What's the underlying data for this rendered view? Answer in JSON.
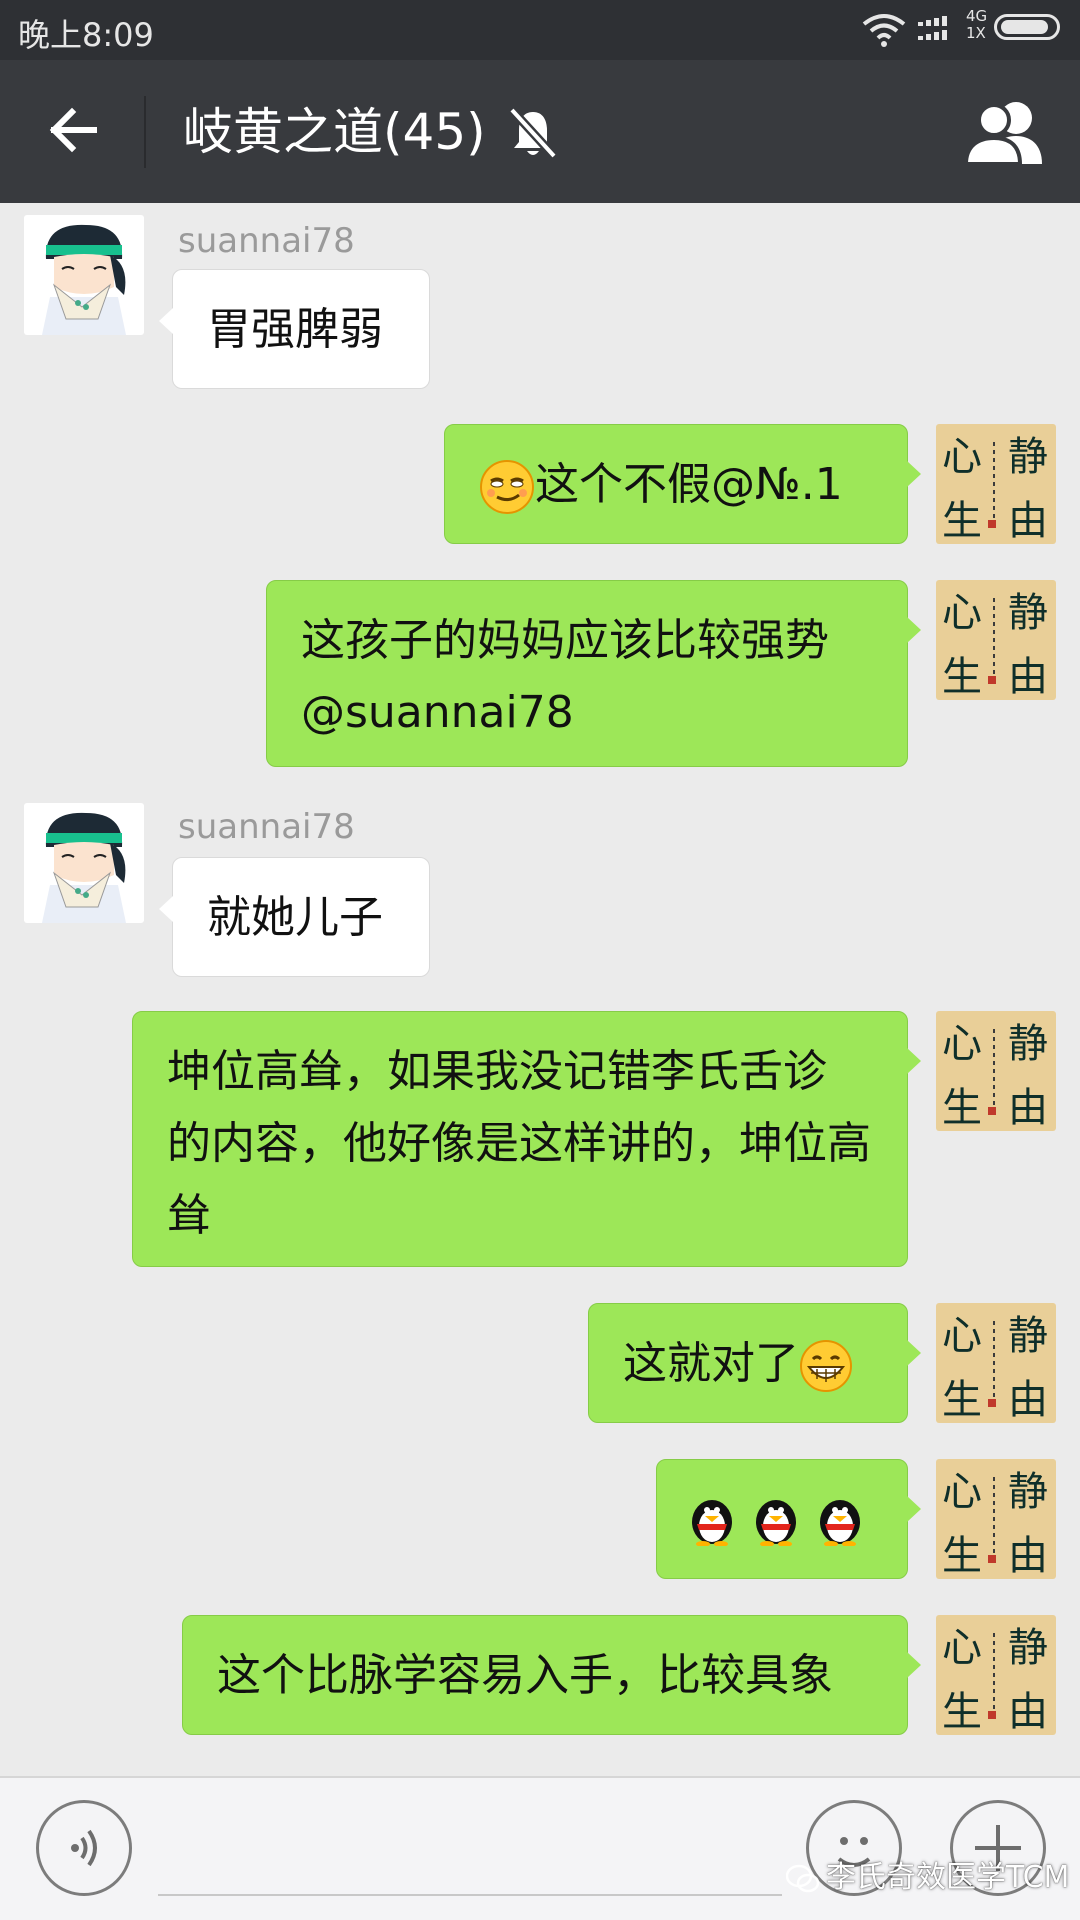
{
  "status_bar": {
    "time": "晚上8:09",
    "network_top": "4G",
    "network_bottom": "1X",
    "battery_level": 0.9
  },
  "header": {
    "back_icon": "arrow-left-icon",
    "title": "岐黄之道(45)",
    "mute_icon": "bell-off-icon",
    "members_icon": "group-icon"
  },
  "messages": [
    {
      "side": "left",
      "sender": "suannai78",
      "text": "胃强脾弱"
    },
    {
      "side": "right",
      "emoji": "smirk-face",
      "text": "这个不假@№.1"
    },
    {
      "side": "right",
      "line1": "这孩子的妈妈应该比较强势",
      "line2": "@suannai78"
    },
    {
      "side": "left",
      "sender": "suannai78",
      "text": "就她儿子"
    },
    {
      "side": "right",
      "line1": "坤位高耸，如果我没记错李氏舌诊",
      "line2": "的内容，他好像是这样讲的，坤位高",
      "line3": "耸"
    },
    {
      "side": "right",
      "text": "这就对了",
      "emoji": "grin-face"
    },
    {
      "side": "right",
      "emojis": [
        "qq-penguin",
        "qq-penguin",
        "qq-penguin"
      ]
    },
    {
      "side": "right",
      "text": "这个比脉学容易入手，比较具象"
    }
  ],
  "input_bar": {
    "voice_icon": "voice-icon",
    "emoji_icon": "emoji-icon",
    "plus_icon": "plus-icon"
  },
  "watermark": "李氏奇效医学TCM",
  "colors": {
    "status_bar_bg": "#2e3034",
    "header_bg": "#383a3e",
    "chat_bg": "#ebebeb",
    "bubble_self": "#9de758",
    "bubble_other": "#ffffff"
  }
}
